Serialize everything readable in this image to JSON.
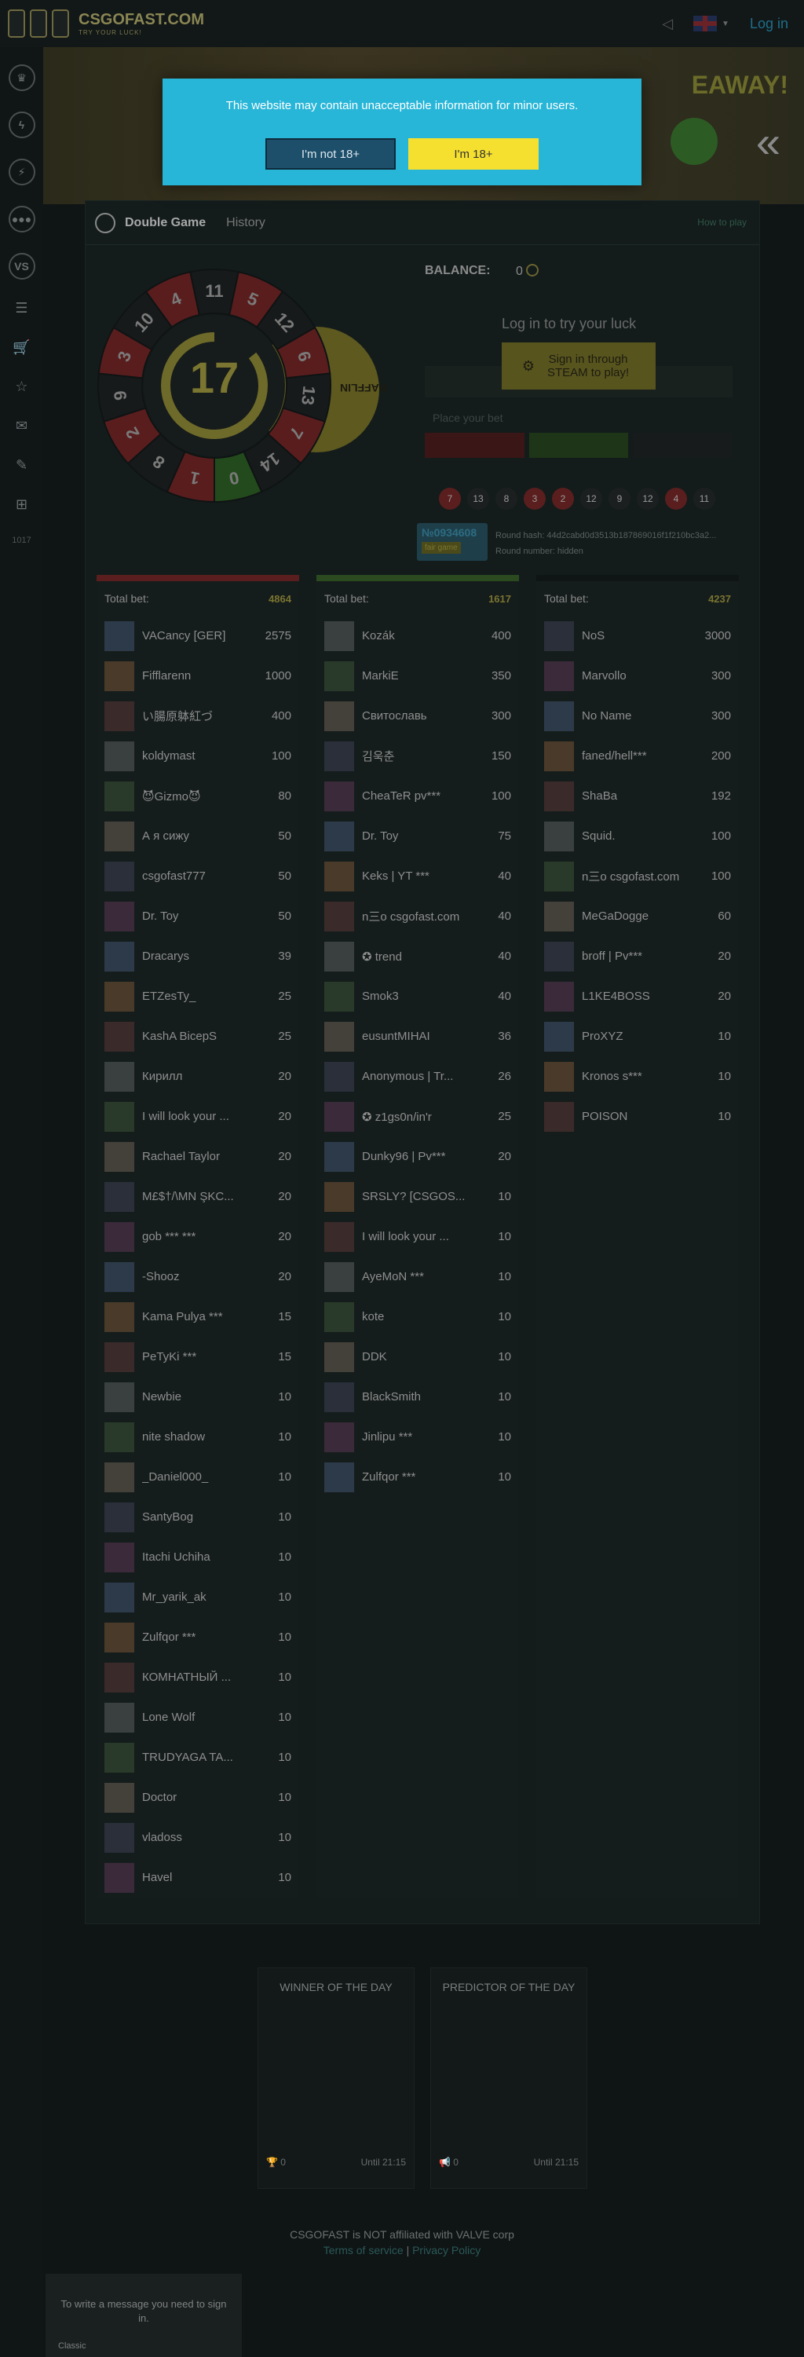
{
  "header": {
    "logo_title": "CSGOFAST.COM",
    "logo_subtitle": "TRY YOUR LUCK!",
    "login_label": "Log in"
  },
  "sidebar": {
    "footer_num": "1017"
  },
  "banner": {
    "text": "EAWAY!"
  },
  "game": {
    "title": "Double Game",
    "history_tab": "History",
    "how_to": "How to play",
    "center_number": "17",
    "raffle_label": "RAFFLIN",
    "wheel_numbers": [
      "11",
      "5",
      "12",
      "6",
      "13",
      "7",
      "14",
      "0",
      "1",
      "8",
      "2",
      "9",
      "3",
      "10",
      "4"
    ],
    "balance_label": "BALANCE:",
    "balance_value": "0",
    "login_prompt": "Log in to try your luck",
    "steam_button": "Sign in through STEAM to play!",
    "bet_placeholder": "Place your bet",
    "history": [
      {
        "n": "7",
        "c": "red"
      },
      {
        "n": "13",
        "c": "black"
      },
      {
        "n": "8",
        "c": "black"
      },
      {
        "n": "3",
        "c": "red"
      },
      {
        "n": "2",
        "c": "red"
      },
      {
        "n": "12",
        "c": "black"
      },
      {
        "n": "9",
        "c": "black"
      },
      {
        "n": "12",
        "c": "black"
      },
      {
        "n": "4",
        "c": "red"
      },
      {
        "n": "11",
        "c": "black"
      }
    ],
    "round_number": "№0934608",
    "fair_label": "fair game",
    "round_hash": "Round hash: 44d2cabd0d3513b187869016f1f210bc3a2...",
    "round_number_text": "Round number: hidden"
  },
  "columns": [
    {
      "color": "#5a1e1e",
      "total_label": "Total bet:",
      "total": "4864",
      "rows": [
        {
          "name": "VACancy [GER]",
          "amount": "2575"
        },
        {
          "name": "Fifflarenn",
          "amount": "1000"
        },
        {
          "name": "い腸原躰紅づ",
          "amount": "400"
        },
        {
          "name": "koldymast",
          "amount": "100"
        },
        {
          "name": "😈Gizmo😈",
          "amount": "80"
        },
        {
          "name": "А я сижу",
          "amount": "50"
        },
        {
          "name": "csgofast777",
          "amount": "50"
        },
        {
          "name": "Dr. Toy",
          "amount": "50"
        },
        {
          "name": "Dracarys",
          "amount": "39"
        },
        {
          "name": "ETZesTy_",
          "amount": "25"
        },
        {
          "name": "KashA BicepS",
          "amount": "25"
        },
        {
          "name": "Кирилл",
          "amount": "20"
        },
        {
          "name": "I will look your ...",
          "amount": "20"
        },
        {
          "name": "Rachael Taylor",
          "amount": "20"
        },
        {
          "name": "M£$†/\\MN ŞKC...",
          "amount": "20"
        },
        {
          "name": "gob *** ***",
          "amount": "20"
        },
        {
          "name": "-Shooz",
          "amount": "20"
        },
        {
          "name": "Kama Pulya ***",
          "amount": "15"
        },
        {
          "name": "PeTyKi ***",
          "amount": "15"
        },
        {
          "name": "Newbie",
          "amount": "10"
        },
        {
          "name": "nite shadow",
          "amount": "10"
        },
        {
          "name": "_Daniel000_",
          "amount": "10"
        },
        {
          "name": "SantyBog",
          "amount": "10"
        },
        {
          "name": "Itachi Uchiha",
          "amount": "10"
        },
        {
          "name": "Mr_yarik_ak",
          "amount": "10"
        },
        {
          "name": "Zulfqor ***",
          "amount": "10"
        },
        {
          "name": "КОМНАТНЫЙ ...",
          "amount": "10"
        },
        {
          "name": "Lone Wolf",
          "amount": "10"
        },
        {
          "name": "TRUDYAGA TA...",
          "amount": "10"
        },
        {
          "name": "Doctor",
          "amount": "10"
        },
        {
          "name": "vladoss",
          "amount": "10"
        },
        {
          "name": "Havel",
          "amount": "10"
        }
      ]
    },
    {
      "color": "#2b4a20",
      "total_label": "Total bet:",
      "total": "1617",
      "rows": [
        {
          "name": "Kozák",
          "amount": "400"
        },
        {
          "name": "MarkiE",
          "amount": "350"
        },
        {
          "name": "Свитославь",
          "amount": "300"
        },
        {
          "name": "김욱춘",
          "amount": "150"
        },
        {
          "name": "CheaTeR pv***",
          "amount": "100"
        },
        {
          "name": "Dr. Toy",
          "amount": "75"
        },
        {
          "name": "Keks | YT ***",
          "amount": "40"
        },
        {
          "name": "n三o csgofast.com",
          "amount": "40"
        },
        {
          "name": "✪ trend",
          "amount": "40"
        },
        {
          "name": "Smok3",
          "amount": "40"
        },
        {
          "name": "eusuntMIHAI",
          "amount": "36"
        },
        {
          "name": "Anonymous | Tr...",
          "amount": "26"
        },
        {
          "name": "✪ z1gs0n/in'r",
          "amount": "25"
        },
        {
          "name": "Dunky96 | Pv***",
          "amount": "20"
        },
        {
          "name": "SRSLY? [CSGOS...",
          "amount": "10"
        },
        {
          "name": "I will look your ...",
          "amount": "10"
        },
        {
          "name": "AyeMoN ***",
          "amount": "10"
        },
        {
          "name": "kote",
          "amount": "10"
        },
        {
          "name": "DDK",
          "amount": "10"
        },
        {
          "name": "BlackSmith",
          "amount": "10"
        },
        {
          "name": "Jinlipu ***",
          "amount": "10"
        },
        {
          "name": "Zulfqor ***",
          "amount": "10"
        }
      ]
    },
    {
      "color": "#0f1414",
      "total_label": "Total bet:",
      "total": "4237",
      "rows": [
        {
          "name": "NoS",
          "amount": "3000"
        },
        {
          "name": "Marvollo",
          "amount": "300"
        },
        {
          "name": "No Name",
          "amount": "300"
        },
        {
          "name": "faned/hell***",
          "amount": "200"
        },
        {
          "name": "ShaBa",
          "amount": "192"
        },
        {
          "name": "Squid.",
          "amount": "100"
        },
        {
          "name": "n三o csgofast.com",
          "amount": "100"
        },
        {
          "name": "MeGaDogge",
          "amount": "60"
        },
        {
          "name": "broff | Pv***",
          "amount": "20"
        },
        {
          "name": "L1KE4BOSS",
          "amount": "20"
        },
        {
          "name": "ProXYZ",
          "amount": "10"
        },
        {
          "name": "Kronos s***",
          "amount": "10"
        },
        {
          "name": "POISON",
          "amount": "10"
        }
      ]
    }
  ],
  "day_cards": [
    {
      "title": "WINNER OF THE DAY",
      "count": "0",
      "time": "Until 21:15"
    },
    {
      "title": "PREDICTOR OF THE DAY",
      "count": "0",
      "time": "Until 21:15"
    }
  ],
  "footer": {
    "disclaimer": "CSGOFAST is NOT affiliated with VALVE corp",
    "terms": "Terms of service",
    "separator": "|",
    "privacy": "Privacy Policy"
  },
  "chat": {
    "message": "To write a message you need to sign in.",
    "lang": "Classic"
  },
  "modal": {
    "text": "This website may contain unacceptable information for minor users.",
    "no_label": "I'm not 18+",
    "yes_label": "I'm 18+"
  }
}
